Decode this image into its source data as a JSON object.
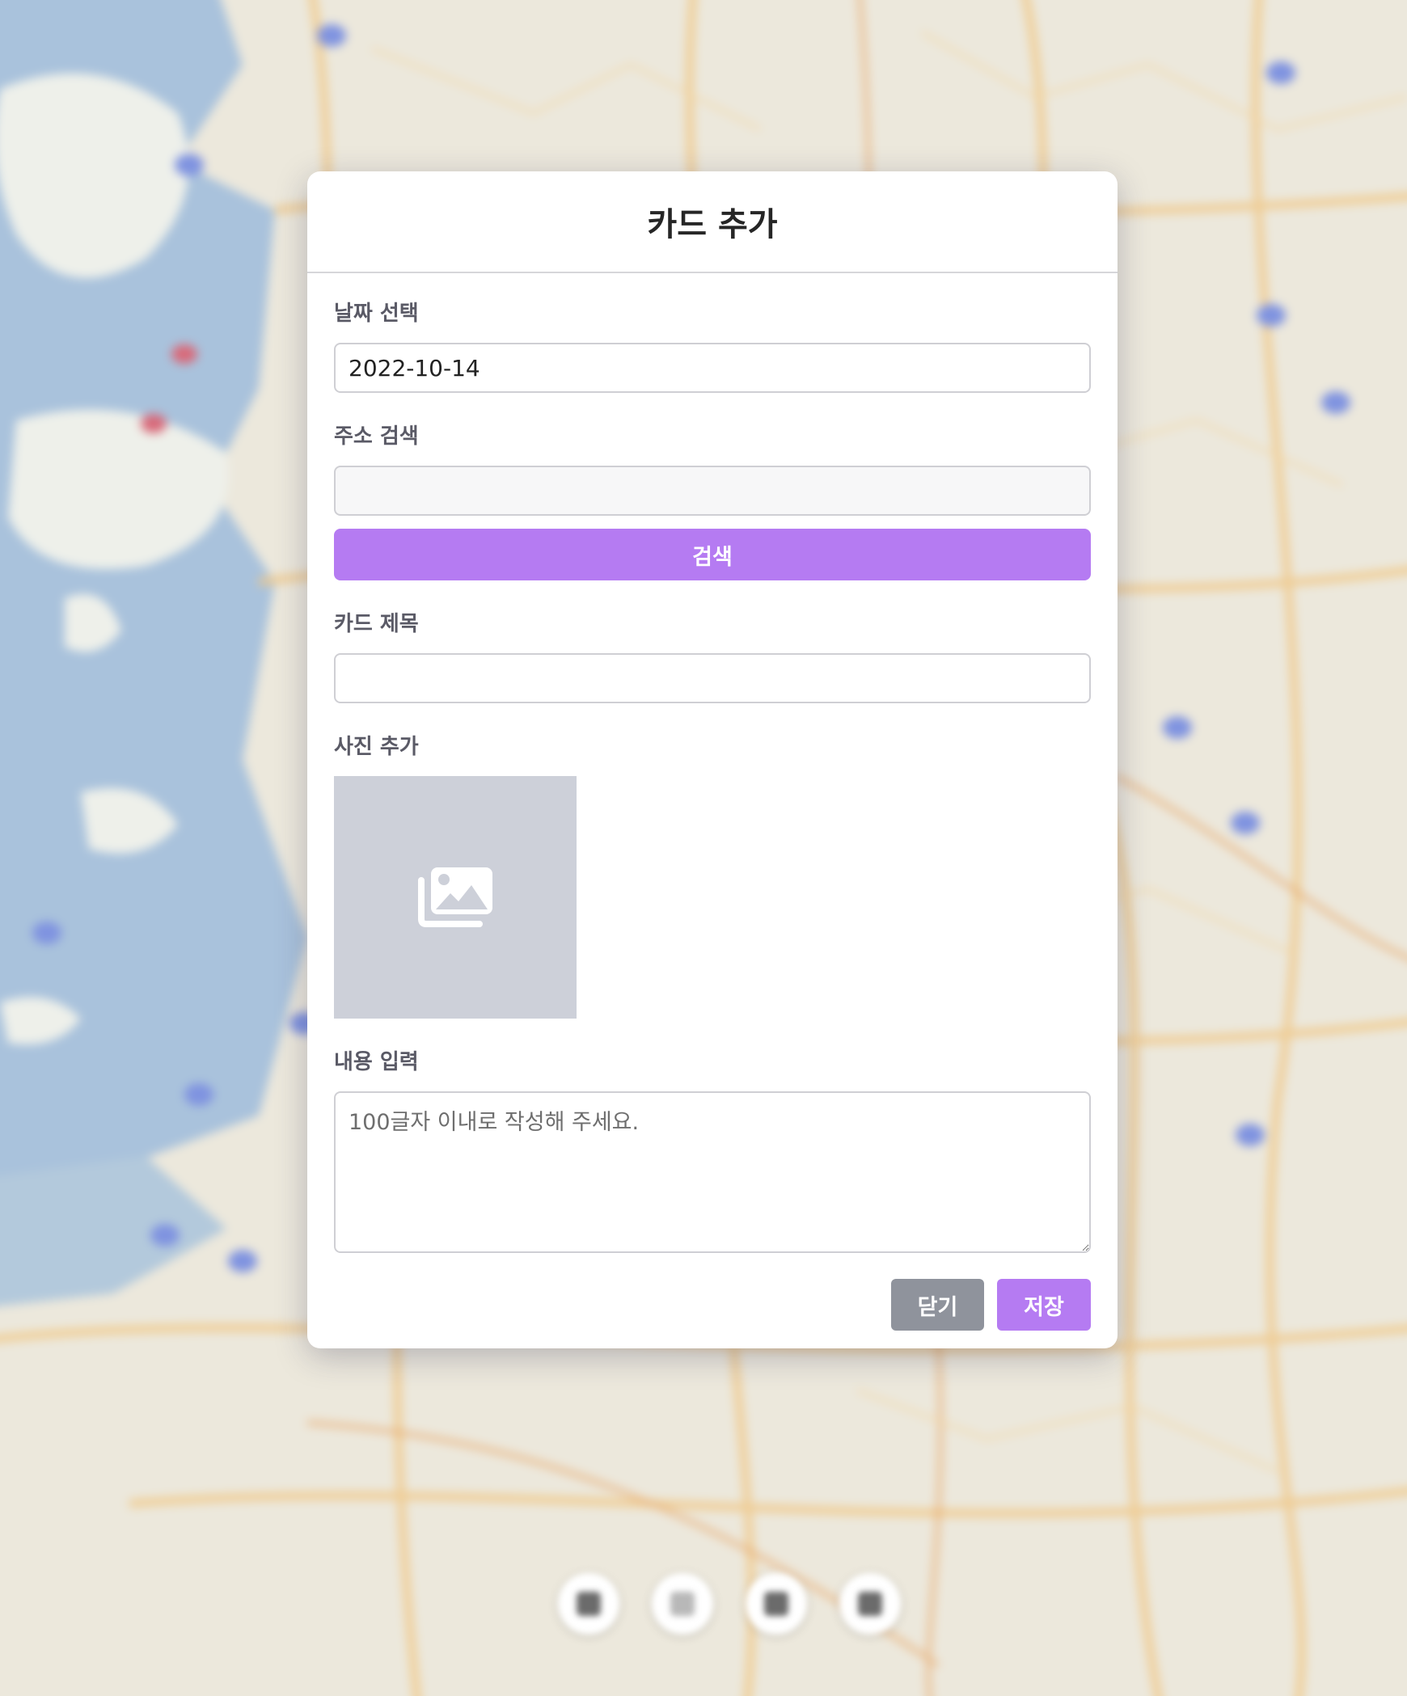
{
  "modal": {
    "title": "카드 추가",
    "date": {
      "label": "날짜 선택",
      "value": "2022-10-14"
    },
    "address": {
      "label": "주소 검색",
      "value": "",
      "search_button": "검색"
    },
    "card_title": {
      "label": "카드 제목",
      "value": ""
    },
    "photo": {
      "label": "사진 추가",
      "icon": "images-icon"
    },
    "content": {
      "label": "내용 입력",
      "placeholder": "100글자 이내로 작성해 주세요."
    },
    "buttons": {
      "close": "닫기",
      "save": "저장"
    }
  },
  "colors": {
    "accent": "#b57bf2",
    "close_button": "#8f939c",
    "photo_placeholder": "#cdd0d9"
  }
}
